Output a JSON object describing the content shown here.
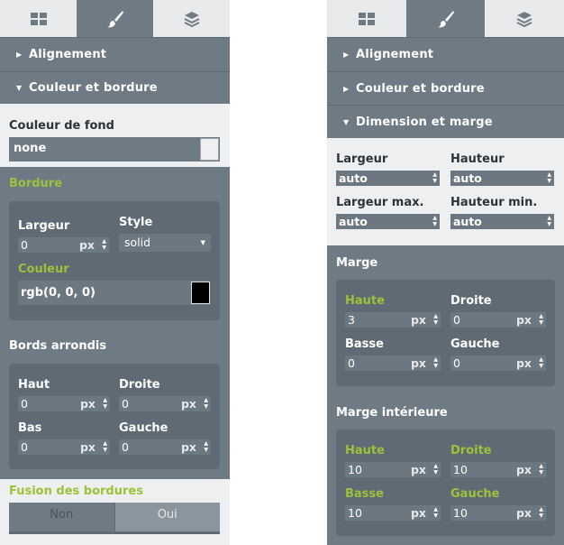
{
  "left": {
    "tabs": [
      "grid-icon",
      "brush-icon",
      "layers-icon"
    ],
    "accordion": [
      {
        "label": "Alignement",
        "open": false
      },
      {
        "label": "Couleur et bordure",
        "open": true
      }
    ],
    "background_color_label": "Couleur de fond",
    "background_color_value": "none",
    "border": {
      "title": "Bordure",
      "width_label": "Largeur",
      "width_value": "0",
      "width_unit": "px",
      "style_label": "Style",
      "style_value": "solid",
      "color_label": "Couleur",
      "color_value": "rgb(0, 0, 0)"
    },
    "radius": {
      "title": "Bords arrondis",
      "top_label": "Haut",
      "top_value": "0",
      "right_label": "Droite",
      "right_value": "0",
      "bottom_label": "Bas",
      "bottom_value": "0",
      "left_label": "Gauche",
      "left_value": "0",
      "unit": "px"
    },
    "collapse": {
      "title": "Fusion des bordures",
      "no_label": "Non",
      "yes_label": "Oui"
    }
  },
  "right": {
    "accordion": [
      {
        "label": "Alignement",
        "open": false
      },
      {
        "label": "Couleur et bordure",
        "open": false
      },
      {
        "label": "Dimension et marge",
        "open": true
      }
    ],
    "dimensions": {
      "width_label": "Largeur",
      "width_value": "auto",
      "height_label": "Hauteur",
      "height_value": "auto",
      "maxwidth_label": "Largeur max.",
      "maxwidth_value": "auto",
      "minheight_label": "Hauteur min.",
      "minheight_value": "auto"
    },
    "margin": {
      "title": "Marge",
      "top_label": "Haute",
      "top_value": "3",
      "right_label": "Droite",
      "right_value": "0",
      "bottom_label": "Basse",
      "bottom_value": "0",
      "left_label": "Gauche",
      "left_value": "0",
      "unit": "px"
    },
    "padding": {
      "title": "Marge intérieure",
      "top_label": "Haute",
      "top_value": "10",
      "right_label": "Droite",
      "right_value": "10",
      "bottom_label": "Basse",
      "bottom_value": "10",
      "left_label": "Gauche",
      "left_value": "10",
      "unit": "px"
    }
  },
  "colors": {
    "accent_green": "#9cc23a",
    "panel": "#6e7b85",
    "card": "#5f6b74"
  }
}
